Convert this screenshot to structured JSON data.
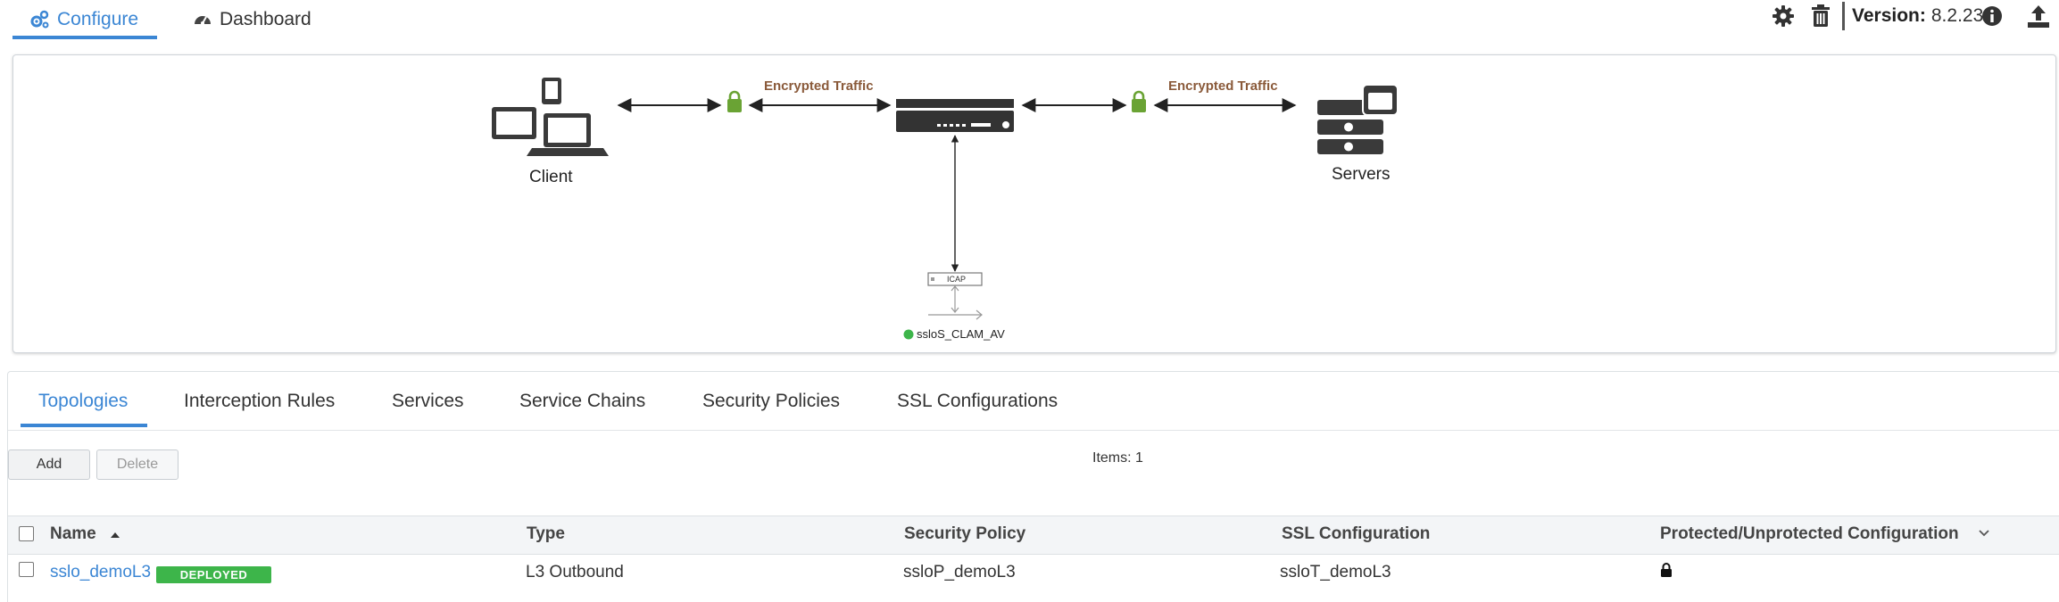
{
  "nav": {
    "configure_label": "Configure",
    "dashboard_label": "Dashboard",
    "version_label": "Version:",
    "version_value": "8.2.23"
  },
  "diagram": {
    "client_label": "Client",
    "servers_label": "Servers",
    "encrypted_left": "Encrypted Traffic",
    "encrypted_right": "Encrypted Traffic",
    "icap_label": "ICAP",
    "service_name": "ssloS_CLAM_AV",
    "service_status_color": "#3db54a"
  },
  "tabs": [
    {
      "label": "Topologies",
      "active": true
    },
    {
      "label": "Interception Rules"
    },
    {
      "label": "Services"
    },
    {
      "label": "Service Chains"
    },
    {
      "label": "Security Policies"
    },
    {
      "label": "SSL Configurations"
    }
  ],
  "toolbar": {
    "add_label": "Add",
    "delete_label": "Delete",
    "items_count": "Items: 1"
  },
  "table": {
    "columns": [
      "Name",
      "Type",
      "Security Policy",
      "SSL Configuration",
      "Protected/Unprotected Configuration"
    ],
    "rows": [
      {
        "name": "sslo_demoL3",
        "status": "DEPLOYED",
        "type": "L3 Outbound",
        "security_policy": "ssloP_demoL3",
        "ssl_configuration": "ssloT_demoL3",
        "protected_icon": "lock-icon"
      }
    ]
  },
  "colors": {
    "accent": "#3b86d4",
    "deployed": "#3db54a",
    "lock": "#6aa334",
    "traffic_label": "#8a5a3a"
  }
}
